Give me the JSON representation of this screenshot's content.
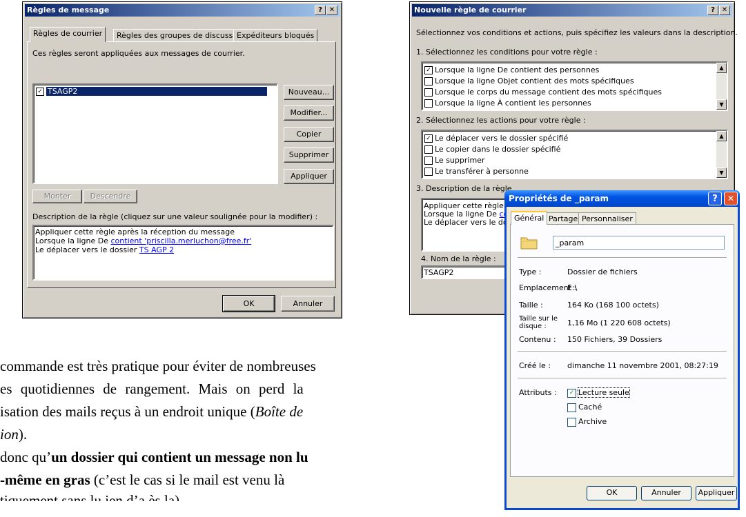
{
  "rules_dialog": {
    "title": "Règles de message",
    "help_btn": "?",
    "close_btn": "✕",
    "tabs": [
      "Règles de courrier",
      "Règles des groupes de discussion",
      "Expéditeurs bloqués"
    ],
    "intro": "Ces règles seront appliquées aux messages de courrier.",
    "rules": [
      {
        "checked": true,
        "name": "TSAGP2"
      }
    ],
    "buttons": [
      "Nouveau...",
      "Modifier...",
      "Copier",
      "Supprimer",
      "Appliquer"
    ],
    "move_up": "Monter",
    "move_down": "Descendre",
    "desc_label": "Description de la règle (cliquez sur une valeur soulignée pour la modifier) :",
    "desc_line1": "Appliquer cette règle après la réception du message",
    "desc_line2_prefix": "Lorsque la ligne De ",
    "desc_line2_link": "contient 'priscilla.merluchon@free.fr'",
    "desc_line3_prefix": "Le déplacer vers le dossier ",
    "desc_line3_link": "TS AGP 2",
    "ok": "OK",
    "cancel": "Annuler"
  },
  "new_rule_dialog": {
    "title": "Nouvelle règle de courrier",
    "help_btn": "?",
    "close_btn": "✕",
    "intro": "Sélectionnez vos conditions et actions, puis spécifiez les valeurs dans la description.",
    "step1": "1. Sélectionnez les conditions pour votre règle :",
    "conditions": [
      {
        "checked": true,
        "label": "Lorsque la ligne De contient des personnes"
      },
      {
        "checked": false,
        "label": "Lorsque la ligne Objet contient des mots spécifiques"
      },
      {
        "checked": false,
        "label": "Lorsque le corps du message contient des mots spécifiques"
      },
      {
        "checked": false,
        "label": "Lorsque la ligne À contient les personnes"
      }
    ],
    "step2": "2. Sélectionnez les actions pour votre règle :",
    "actions": [
      {
        "checked": true,
        "label": "Le déplacer vers le dossier spécifié"
      },
      {
        "checked": false,
        "label": "Le copier dans le dossier spécifié"
      },
      {
        "checked": false,
        "label": "Le supprimer"
      },
      {
        "checked": false,
        "label": "Le transférer à personne"
      }
    ],
    "step3": "3. Description de la règle",
    "desc_line1": "Appliquer cette règle ap",
    "desc_line2_prefix": "Lorsque la ligne De ",
    "desc_line2_link": "con",
    "desc_line3": "Le déplacer vers le doss",
    "step4": "4. Nom de la règle :",
    "rule_name": "TSAGP2"
  },
  "props_dialog": {
    "title": "Propriétés de _param",
    "help_btn": "?",
    "close_btn": "✕",
    "tabs": [
      "Général",
      "Partage",
      "Personnaliser"
    ],
    "folder_name": "_param",
    "rows": [
      {
        "label": "Type :",
        "value": "Dossier de fichiers"
      },
      {
        "label": "Emplacement :",
        "value": "E:\\"
      },
      {
        "label": "Taille :",
        "value": "164 Ko (168 100 octets)"
      },
      {
        "label": "Taille sur le disque :",
        "value": "1,16 Mo (1 220 608 octets)"
      },
      {
        "label": "Contenu :",
        "value": "150 Fichiers, 39 Dossiers"
      }
    ],
    "created_label": "Créé le :",
    "created_value": "dimanche 11 novembre 2001, 08:27:19",
    "attributes_label": "Attributs :",
    "attributes": [
      {
        "checked": true,
        "label": "Lecture seule"
      },
      {
        "checked": false,
        "label": "Caché"
      },
      {
        "checked": false,
        "label": "Archive"
      }
    ],
    "ok": "OK",
    "cancel": "Annuler",
    "apply": "Appliquer"
  },
  "body_text": {
    "line1": "commande est très pratique pour éviter de nombreuses",
    "line2": "es quotidiennes de rangement.   Mais on perd la",
    "line3_prefix": "isation des mails reçus à un endroit unique (",
    "line3_italic": "Boîte de",
    "line4_italic": "ion",
    "line4_suffix": ").",
    "line5_prefix": "donc qu’",
    "line5_bold": "un dossier qui contient un message non lu",
    "line6_bold": "-même en gras",
    "line6_suffix": " (c’est le cas si le mail est venu là",
    "line7": "tiquement sans lu ien d’a   ès la)"
  }
}
